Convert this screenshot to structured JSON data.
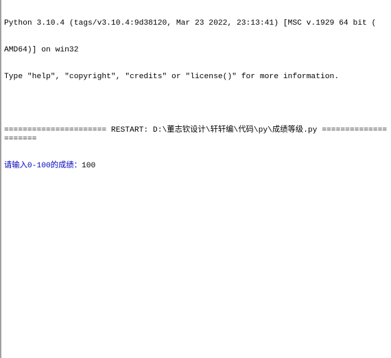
{
  "shell": {
    "banner_line1": "Python 3.10.4 (tags/v3.10.4:9d38120, Mar 23 2022, 23:13:41) [MSC v.1929 64 bit (",
    "banner_line2": "AMD64)] on win32",
    "banner_line3": "Type \"help\", \"copyright\", \"credits\" or \"license()\" for more information.",
    "restart_line": "====================== RESTART: D:\\董志钦设计\\轩轩编\\代码\\py\\成绩等级.py =====================",
    "input_prompt": "请输入0-100的成绩：",
    "input_value": "100"
  },
  "colors": {
    "prompt": "#0000c0",
    "text": "#000000"
  }
}
